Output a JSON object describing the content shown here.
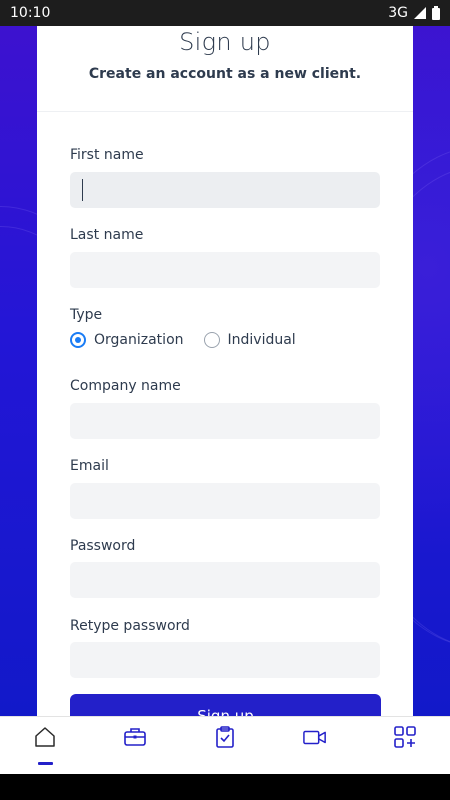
{
  "status_bar": {
    "time": "10:10",
    "network": "3G"
  },
  "header": {
    "title": "Sign up",
    "subtitle": "Create an account as a new client."
  },
  "form": {
    "first_name": {
      "label": "First name",
      "value": ""
    },
    "last_name": {
      "label": "Last name",
      "value": ""
    },
    "type": {
      "label": "Type",
      "options": [
        "Organization",
        "Individual"
      ],
      "selected": "Organization"
    },
    "company_name": {
      "label": "Company name",
      "value": ""
    },
    "email": {
      "label": "Email",
      "value": ""
    },
    "password": {
      "label": "Password",
      "value": ""
    },
    "retype_password": {
      "label": "Retype password",
      "value": ""
    },
    "submit_label": "Sign up"
  },
  "bottom_nav": {
    "items": [
      {
        "icon": "home-icon",
        "active": true
      },
      {
        "icon": "briefcase-icon",
        "active": false
      },
      {
        "icon": "clipboard-check-icon",
        "active": false
      },
      {
        "icon": "video-camera-icon",
        "active": false
      },
      {
        "icon": "apps-add-icon",
        "active": false
      }
    ]
  },
  "colors": {
    "accent": "#2320c9",
    "radio_accent": "#1a7cf5",
    "text": "#2e3b4e",
    "input_bg": "#f3f4f6"
  }
}
